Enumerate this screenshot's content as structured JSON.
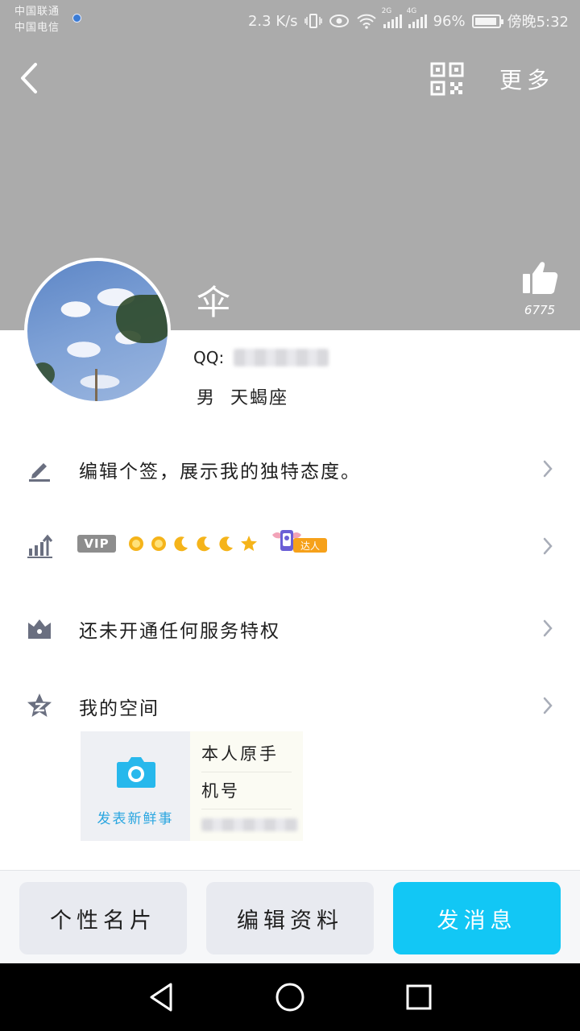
{
  "status_bar": {
    "carrier_1": "中国联通",
    "carrier_2": "中国电信",
    "speed": "2.3 K/s",
    "net_2g": "2G",
    "net_4g": "4G",
    "battery": "96%",
    "time": "傍晚5:32"
  },
  "nav": {
    "back_icon": "chevron-left-icon",
    "qr_icon": "qr-code-icon",
    "more_label": "更多"
  },
  "profile": {
    "nickname": "伞",
    "qq_label": "QQ:",
    "gender": "男",
    "zodiac": "天蝎座",
    "likes": "6775"
  },
  "rows": {
    "signature": "编辑个签，展示我的独特态度。",
    "vip_badge": "VIP",
    "daren_label": "达人",
    "privilege": "还未开通任何服务特权",
    "zone": "我的空间"
  },
  "zone_card": {
    "post_label": "发表新鲜事",
    "post_line1": "本人原手",
    "post_line2": "机号"
  },
  "actions": {
    "card": "个性名片",
    "edit": "编辑资料",
    "message": "发消息"
  },
  "colors": {
    "header_gray": "#ababab",
    "accent_blue": "#12c7f5",
    "icon_gray": "#6a6f80"
  }
}
